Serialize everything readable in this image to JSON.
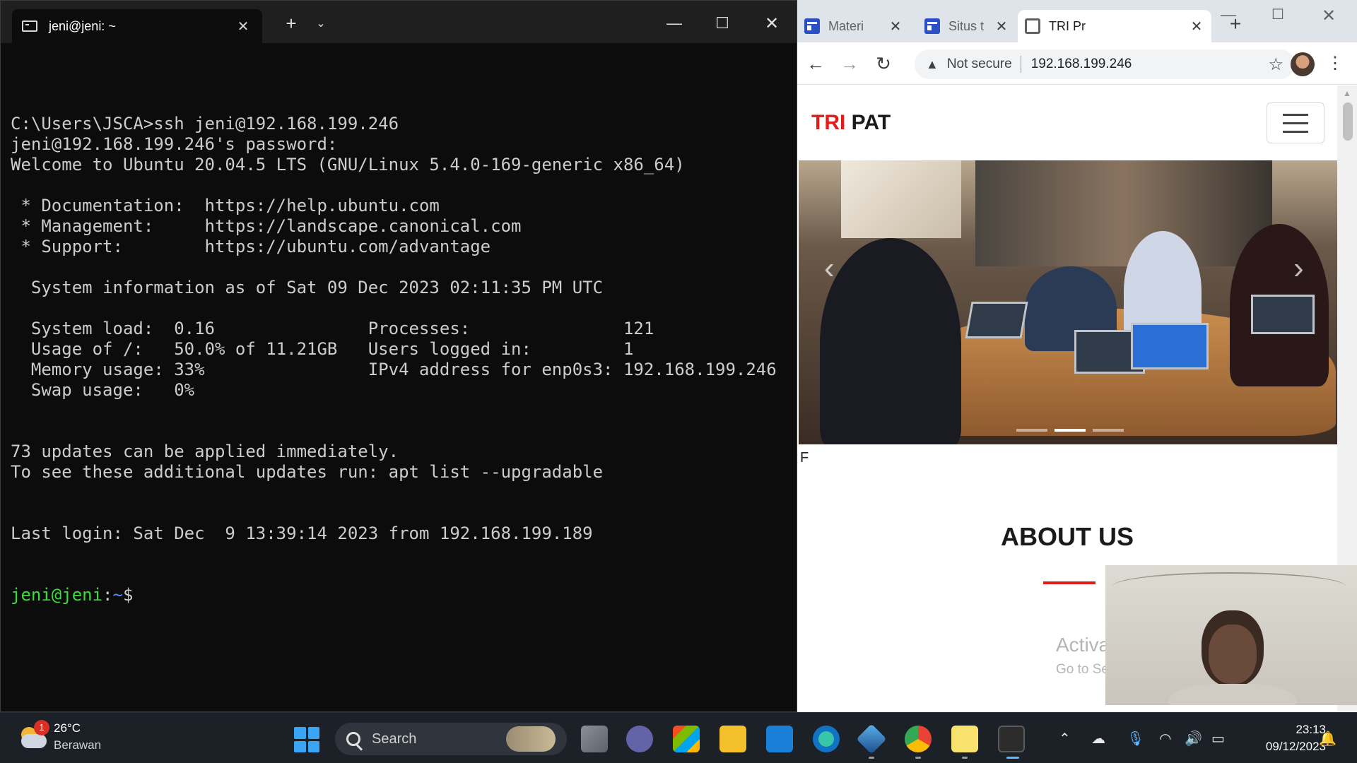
{
  "terminal": {
    "tab_title": "jeni@jeni: ~",
    "tab_close": "✕",
    "new_tab": "+",
    "dropdown": "⌄",
    "minimize": "—",
    "maximize": "☐",
    "close": "✕",
    "lines": [
      "C:\\Users\\JSCA>ssh jeni@192.168.199.246",
      "jeni@192.168.199.246's password:",
      "Welcome to Ubuntu 20.04.5 LTS (GNU/Linux 5.4.0-169-generic x86_64)",
      "",
      " * Documentation:  https://help.ubuntu.com",
      " * Management:     https://landscape.canonical.com",
      " * Support:        https://ubuntu.com/advantage",
      "",
      "  System information as of Sat 09 Dec 2023 02:11:35 PM UTC",
      "",
      "  System load:  0.16               Processes:               121",
      "  Usage of /:   50.0% of 11.21GB   Users logged in:         1",
      "  Memory usage: 33%                IPv4 address for enp0s3: 192.168.199.246",
      "  Swap usage:   0%",
      "",
      "",
      "73 updates can be applied immediately.",
      "To see these additional updates run: apt list --upgradable",
      "",
      "",
      "Last login: Sat Dec  9 13:39:14 2023 from 192.168.199.189"
    ],
    "prompt_user": "jeni@jeni",
    "prompt_sep": ":",
    "prompt_path": "~",
    "prompt_symbol": "$"
  },
  "browser": {
    "tabs": [
      {
        "title": "Materi",
        "icon": "outlook-calendar-icon"
      },
      {
        "title": "Situs t",
        "icon": "site-icon"
      },
      {
        "title": "TRI Pr",
        "icon": "globe-icon",
        "active": true
      }
    ],
    "tab_close": "✕",
    "new_tab": "+",
    "minimize": "—",
    "maximize": "☐",
    "close": "✕",
    "back": "←",
    "forward": "→",
    "reload": "↻",
    "security_icon": "▲",
    "security_label": "Not secure",
    "url": "192.168.199.246",
    "bookmark": "☆",
    "menu": "⋮"
  },
  "page": {
    "brand_part1": "TRI",
    "brand_part2": "PAT",
    "carousel_prev": "‹",
    "carousel_next": "›",
    "carousel_slides": 3,
    "carousel_active": 2,
    "stray_text": "F",
    "about_title": "ABOUT US",
    "watermark_title": "Activate Windows",
    "watermark_sub": "Go to Settings to activate Windows."
  },
  "taskbar": {
    "weather_temp": "26°C",
    "weather_desc": "Berawan",
    "weather_badge": "1",
    "search_placeholder": "Search",
    "time": "23:13",
    "date": "09/12/2023",
    "tray_chevron": "⌃",
    "tray_onedrive": "☁",
    "tray_mic": "🎙",
    "tray_wifi": "◠",
    "tray_volume": "🔊",
    "tray_battery": "▭",
    "tray_notif": "🔔"
  }
}
